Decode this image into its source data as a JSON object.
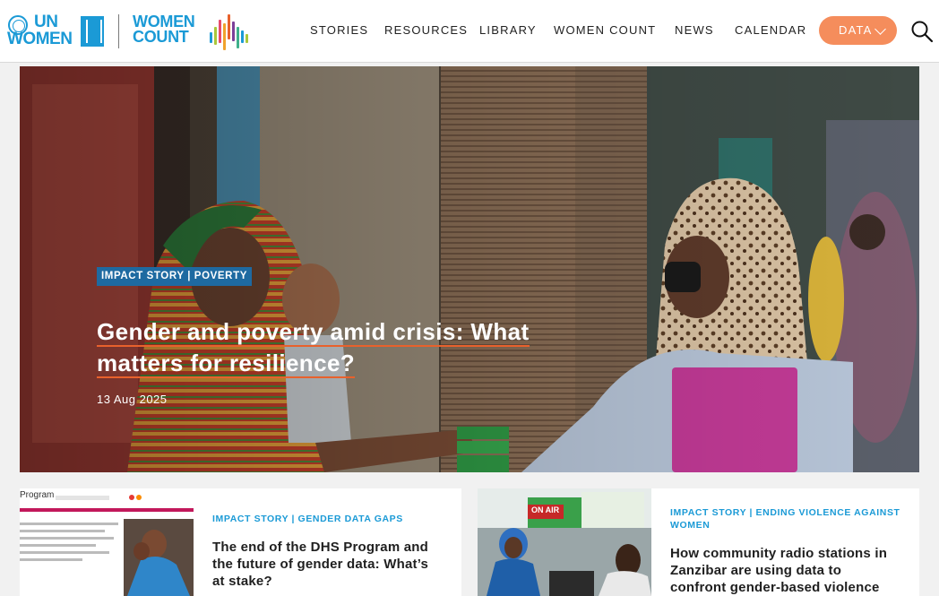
{
  "brand": {
    "un_line": "UN",
    "women_line": "WOMEN",
    "women_count_line1": "WOMEN",
    "women_count_line2": "COUNT"
  },
  "nav": {
    "items": [
      "STORIES",
      "RESOURCES",
      "LIBRARY",
      "WOMEN COUNT",
      "NEWS",
      "CALENDAR"
    ],
    "data_button": "DATA"
  },
  "hero": {
    "tag": "IMPACT STORY | POVERTY",
    "title_line1": "Gender and poverty amid crisis: What",
    "title_line2": "matters for resilience?",
    "date": "13 Aug 2025"
  },
  "cards": [
    {
      "tag": "IMPACT STORY | GENDER DATA GAPS",
      "title_lines": [
        "The end of the DHS Program and",
        "the future of gender data: What’s",
        "at stake?"
      ],
      "thumb_text": "Program"
    },
    {
      "tag_lines": [
        "IMPACT STORY | ENDING VIOLENCE AGAINST",
        "WOMEN"
      ],
      "title_lines": [
        "How community radio stations in",
        "Zanzibar are using data to",
        "confront gender-based violence"
      ],
      "thumb_text": "ON AIR"
    }
  ],
  "colors": {
    "brand_blue": "#1b9ad6",
    "accent_orange": "#f58d5c",
    "tag_blue": "#1e6aa1",
    "underline_orange": "#e8612c"
  },
  "icons": [
    "un-women-logo",
    "women-count-logo",
    "chevron-down-icon",
    "search-icon"
  ]
}
